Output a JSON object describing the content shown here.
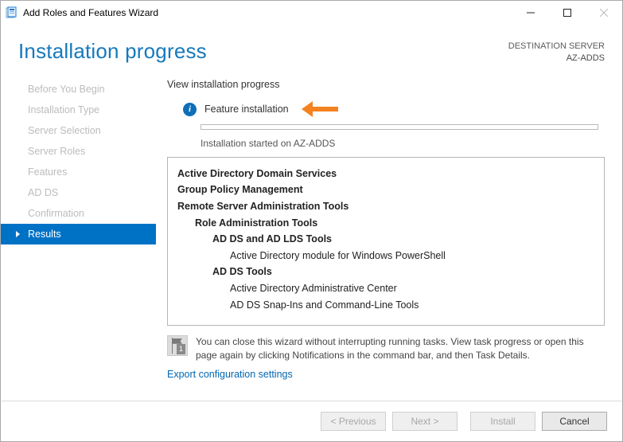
{
  "window": {
    "title": "Add Roles and Features Wizard"
  },
  "header": {
    "title": "Installation progress",
    "dest_label": "DESTINATION SERVER",
    "dest_value": "AZ-ADDS"
  },
  "sidebar": {
    "items": [
      {
        "label": "Before You Begin"
      },
      {
        "label": "Installation Type"
      },
      {
        "label": "Server Selection"
      },
      {
        "label": "Server Roles"
      },
      {
        "label": "Features"
      },
      {
        "label": "AD DS"
      },
      {
        "label": "Confirmation"
      },
      {
        "label": "Results"
      }
    ]
  },
  "main": {
    "section_title": "View installation progress",
    "status_text": "Feature installation",
    "started_text": "Installation started on AZ-ADDS",
    "tree": {
      "l0a": "Active Directory Domain Services",
      "l0b": "Group Policy Management",
      "l0c": "Remote Server Administration Tools",
      "l1a": "Role Administration Tools",
      "l2a": "AD DS and AD LDS Tools",
      "l3a": "Active Directory module for Windows PowerShell",
      "l2b": "AD DS Tools",
      "l3b": "Active Directory Administrative Center",
      "l3c": "AD DS Snap-Ins and Command-Line Tools"
    },
    "note_text": "You can close this wizard without interrupting running tasks. View task progress or open this page again by clicking Notifications in the command bar, and then Task Details.",
    "export_link": "Export configuration settings"
  },
  "footer": {
    "previous": "< Previous",
    "next": "Next >",
    "install": "Install",
    "cancel": "Cancel"
  }
}
